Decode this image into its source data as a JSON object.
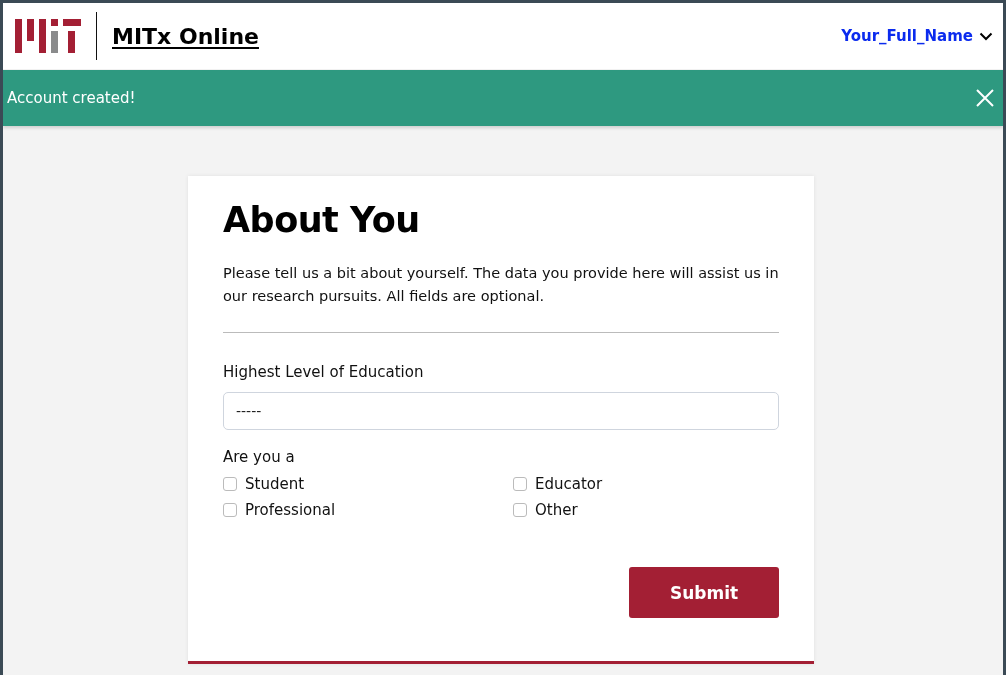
{
  "header": {
    "site_title": "MITx Online",
    "user_menu": "Your_Full_Name"
  },
  "alert": {
    "message": "Account created!"
  },
  "form": {
    "title": "About You",
    "intro": "Please tell us a bit about yourself. The data you provide here will assist us in our research pursuits. All fields are optional.",
    "education": {
      "label": "Highest Level of Education",
      "value": "-----"
    },
    "role_label": "Are you a",
    "roles": [
      {
        "label": "Student",
        "checked": false
      },
      {
        "label": "Educator",
        "checked": false
      },
      {
        "label": "Professional",
        "checked": false
      },
      {
        "label": "Other",
        "checked": false
      }
    ],
    "submit": "Submit"
  }
}
